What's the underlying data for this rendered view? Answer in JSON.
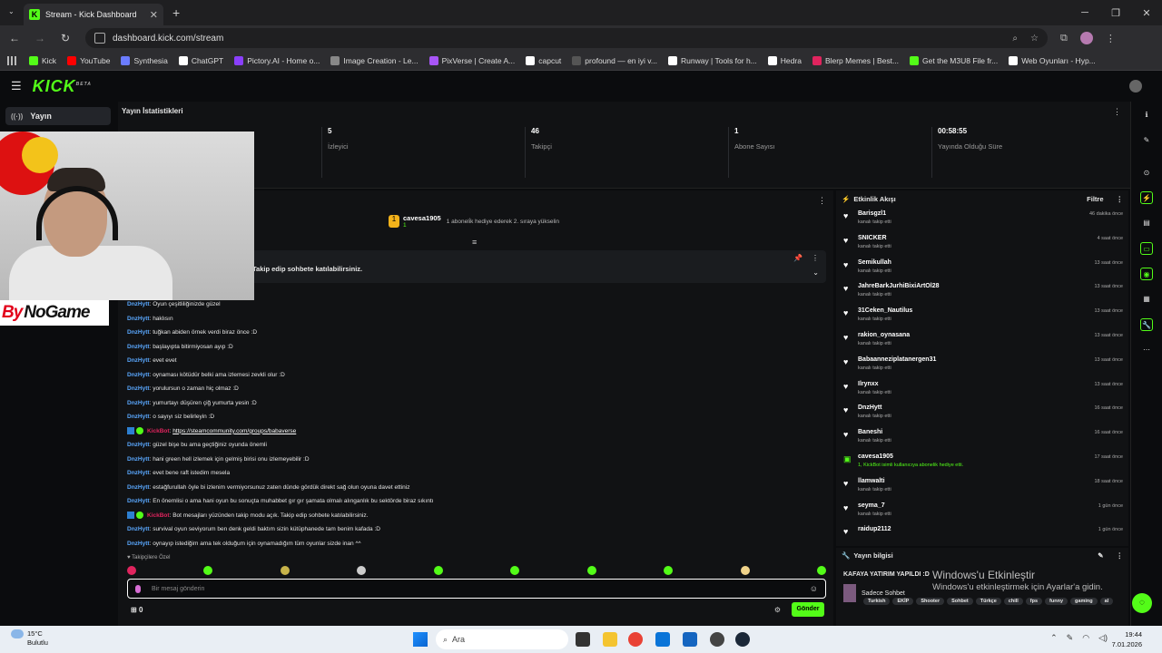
{
  "browser": {
    "tab_title": "Stream - Kick Dashboard",
    "url": "dashboard.kick.com/stream",
    "bookmarks": [
      {
        "label": "Kick",
        "color": "#53fc18"
      },
      {
        "label": "YouTube",
        "color": "#ff0000"
      },
      {
        "label": "Synthesia",
        "color": "#6b7cff"
      },
      {
        "label": "ChatGPT",
        "color": "#ffffff"
      },
      {
        "label": "Pictory.AI - Home o...",
        "color": "#8a3ffc"
      },
      {
        "label": "Image Creation - Le...",
        "color": "#888888"
      },
      {
        "label": "PixVerse | Create A...",
        "color": "#a855f7"
      },
      {
        "label": "capcut",
        "color": "#ffffff"
      },
      {
        "label": "profound — en iyi v...",
        "color": "#555555"
      },
      {
        "label": "Runway | Tools for h...",
        "color": "#ffffff"
      },
      {
        "label": "Hedra",
        "color": "#ffffff"
      },
      {
        "label": "Blerp Memes | Best...",
        "color": "#e0245e"
      },
      {
        "label": "Get the M3U8 File fr...",
        "color": "#53fc18"
      },
      {
        "label": "Web Oyunları - Hyp...",
        "color": "#ffffff"
      }
    ]
  },
  "kick": {
    "logo": "KICK",
    "logo_sup": "BETA",
    "sidebar_item": "Yayın"
  },
  "overlay": {
    "brand_prefix": "By",
    "brand": "NoGame"
  },
  "stats": {
    "title": "Yayın İstatistikleri",
    "items": [
      {
        "value": "5",
        "label": "İzleyici"
      },
      {
        "value": "46",
        "label": "Takipçi"
      },
      {
        "value": "1",
        "label": "Abone Sayısı"
      },
      {
        "value": "00:58:55",
        "label": "Yayında Olduğu Süre"
      }
    ]
  },
  "chat": {
    "sub_goal": {
      "name": "cavesa1905",
      "count": "1",
      "info": "1 aboneli̇k hediye ederek 2. sıraya yükselin"
    },
    "pinned": "Takip edip sohbete katılabilirsiniz.",
    "messages": [
      {
        "user": "DnzHytt",
        "text": "Oyun çeşitliliğinizde güzel"
      },
      {
        "user": "DnzHytt",
        "text": "haklısın"
      },
      {
        "user": "DnzHytt",
        "text": "tuğkan abiden örnek verdi biraz önce :D"
      },
      {
        "user": "DnzHytt",
        "text": "başlayıpta bitirmiyosan ayıp :D"
      },
      {
        "user": "DnzHytt",
        "text": "evet evet"
      },
      {
        "user": "DnzHytt",
        "text": "oynaması kötüdür belki ama izlemesi zevkli olur :D"
      },
      {
        "user": "DnzHytt",
        "text": "yorulursun o zaman hiç olmaz :D"
      },
      {
        "user": "DnzHytt",
        "text": "yumurtayı düşüren çiğ yumurta yesin :D"
      },
      {
        "user": "DnzHytt",
        "text": "o sayıyı siz belirleyin :D"
      },
      {
        "user": "KickBot",
        "text": "https://steamcommunity.com/groups/babaverse",
        "bot": true,
        "link": true
      },
      {
        "user": "DnzHytt",
        "text": "güzel bişe bu ama geçtiğiniz oyunda önemli"
      },
      {
        "user": "DnzHytt",
        "text": "hani green hell izlemek için gelmiş birisi onu izlemeyebilir :D"
      },
      {
        "user": "DnzHytt",
        "text": "evet bene raft istedim mesela"
      },
      {
        "user": "DnzHytt",
        "text": "estağfurullah öyle bi izlenim vermiyorsunuz zaten dünde gördük direkt sağ olun oyuna davet ettiniz"
      },
      {
        "user": "DnzHytt",
        "text": "En önemlisi o ama hani oyun bu sonuçta muhabbet gır gır şamata olmalı alınganlık bu sektörde biraz sıkıntı"
      },
      {
        "user": "KickBot",
        "text": "Bot mesajları yüzünden takip modu açık. Takip edip sohbete katılabilirsiniz.",
        "bot": true
      },
      {
        "user": "DnzHytt",
        "text": "survival oyun seviyorum ben denk geldi baktım sizin kütüphanede tam benim kafada :D"
      },
      {
        "user": "DnzHytt",
        "text": "oynayıp istediğim ama tek olduğum için oynamadığım tüm oyunlar sizde inan ^^"
      }
    ],
    "follower_only": "Takipçilere Özel",
    "input_placeholder": "Bir mesaj gönderin",
    "points": "0",
    "send_label": "Gönder"
  },
  "activity": {
    "title": "Etkinlik Akışı",
    "filter_label": "Filtre",
    "items": [
      {
        "name": "Barisgzl1",
        "sub": "kanalı takip etti",
        "time": "46 dakika önce"
      },
      {
        "name": "SNICKER",
        "sub": "kanalı takip etti",
        "time": "4 saat önce"
      },
      {
        "name": "Semikullah",
        "sub": "kanalı takip etti",
        "time": "13 saat önce"
      },
      {
        "name": "JahreBarkJurhiBixiArtOl28",
        "sub": "kanalı takip etti",
        "time": "13 saat önce"
      },
      {
        "name": "31Ceken_Nautilus",
        "sub": "kanalı takip etti",
        "time": "13 saat önce"
      },
      {
        "name": "rakion_oynasana",
        "sub": "kanalı takip etti",
        "time": "13 saat önce"
      },
      {
        "name": "Babaanneziplatanergen31",
        "sub": "kanalı takip etti",
        "time": "13 saat önce"
      },
      {
        "name": "Ilrynxx",
        "sub": "kanalı takip etti",
        "time": "13 saat önce"
      },
      {
        "name": "DnzHytt",
        "sub": "kanalı takip etti",
        "time": "16 saat önce"
      },
      {
        "name": "Baneshi",
        "sub": "kanalı takip etti",
        "time": "16 saat önce"
      },
      {
        "name": "cavesa1905",
        "sub": "1, KickBot isimli kullanıcıya abonelik hediye etti.",
        "time": "17 saat önce",
        "gift": true
      },
      {
        "name": "llamwalti",
        "sub": "kanalı takip etti",
        "time": "18 saat önce"
      },
      {
        "name": "seyma_7",
        "sub": "kanalı takip etti",
        "time": "1 gün önce"
      },
      {
        "name": "raidup2112",
        "sub": "",
        "time": "1 gün önce"
      }
    ]
  },
  "stream_info": {
    "title": "Yayın bilgisi",
    "stream_title": "KAFAYA YATIRIM YAPILDI :D",
    "category": "Sadece Sohbet",
    "tags": [
      "Turkish",
      "EKİP",
      "Shooter",
      "Sohbet",
      "Türkçe",
      "chill",
      "fps",
      "funny",
      "gaming",
      "al"
    ]
  },
  "windows": {
    "watermark_title": "Windows'u Etkinleştir",
    "watermark_sub": "Windows'u etkinleştirmek için Ayarlar'a gidin.",
    "weather_temp": "15°C",
    "weather_desc": "Bulutlu",
    "search_label": "Ara",
    "time": "19:44",
    "date": "7.01.2026"
  }
}
